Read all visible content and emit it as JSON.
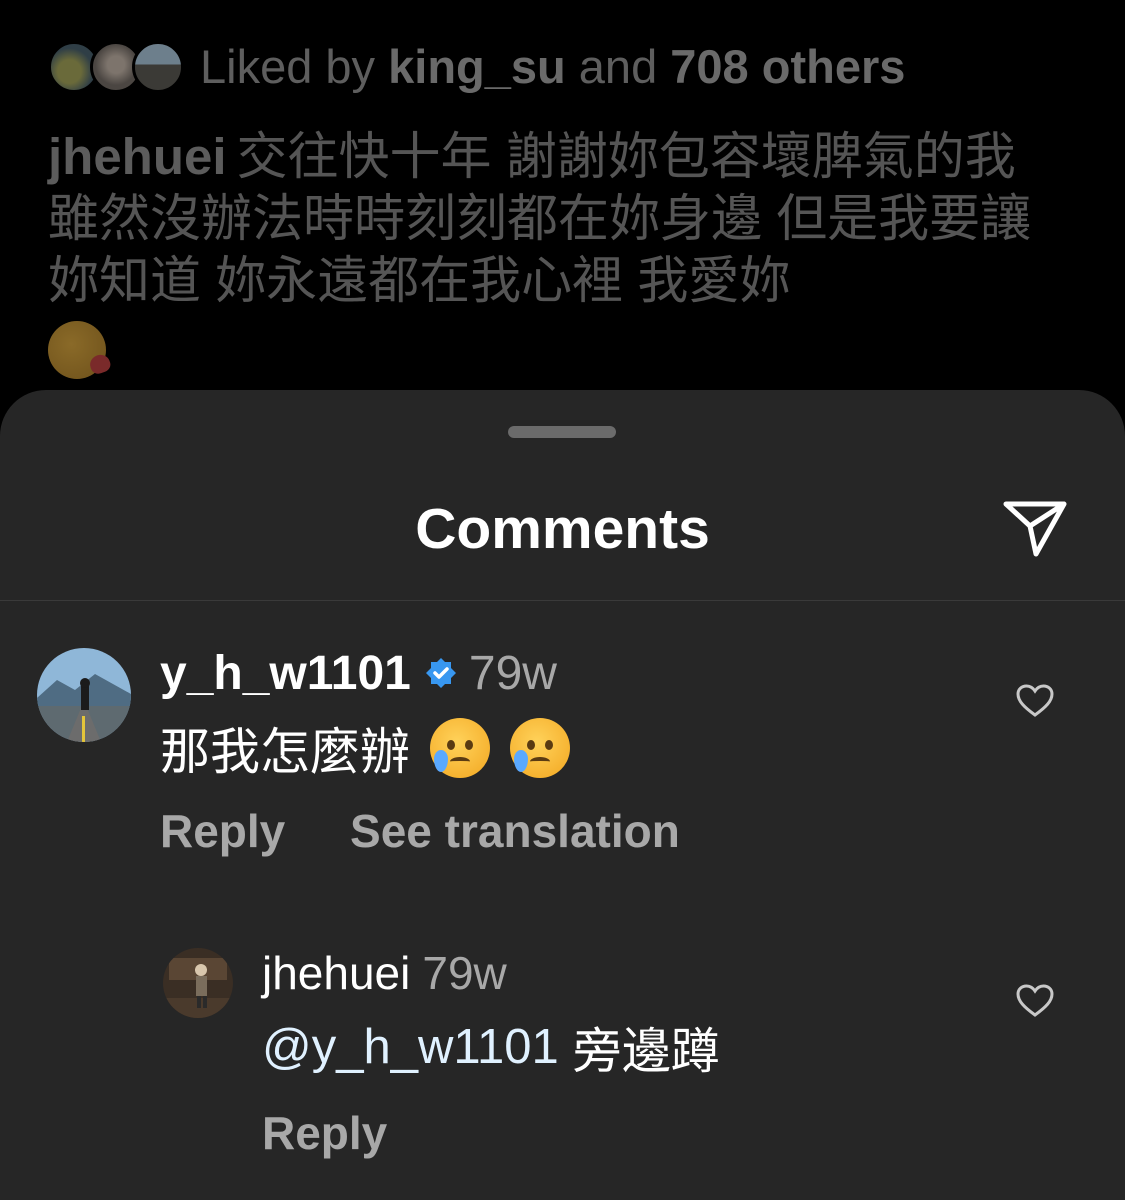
{
  "post": {
    "likes": {
      "prefix": "Liked by",
      "user": "king_su",
      "middle": "and",
      "others": "708 others"
    },
    "caption": {
      "username": "jhehuei",
      "text": "交往快十年 謝謝妳包容壞脾氣的我 雖然沒辦法時時刻刻都在妳身邊 但是我要讓妳知道 妳永遠都在我心裡 我愛妳",
      "emoji": "face-blowing-a-kiss"
    }
  },
  "sheet": {
    "title": "Comments",
    "share_icon": "paper-plane-icon"
  },
  "comments": [
    {
      "username": "y_h_w1101",
      "verified": true,
      "time": "79w",
      "text": "那我怎麼辦",
      "emoji": [
        "crying-face",
        "crying-face"
      ],
      "actions": {
        "reply": "Reply",
        "translate": "See translation"
      }
    },
    {
      "username": "jhehuei",
      "time": "79w",
      "mention": "@y_h_w1101",
      "text": "旁邊蹲",
      "actions": {
        "reply": "Reply"
      }
    }
  ],
  "colors": {
    "sheet_bg": "#262626",
    "verified_blue": "#3897f0",
    "secondary_text": "#a8a8a8",
    "mention": "#e0f1ff"
  }
}
